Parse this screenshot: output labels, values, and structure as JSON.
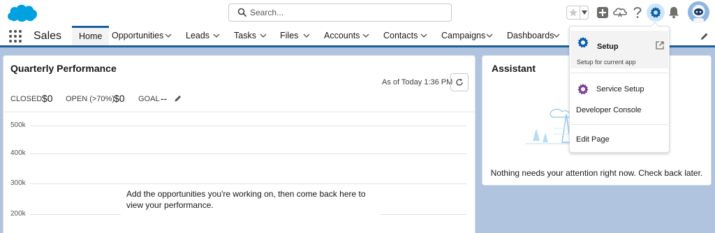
{
  "header": {
    "search_placeholder": "Search..."
  },
  "nav": {
    "app_name": "Sales",
    "tabs": [
      {
        "label": "Home"
      },
      {
        "label": "Opportunities"
      },
      {
        "label": "Leads"
      },
      {
        "label": "Tasks"
      },
      {
        "label": "Files"
      },
      {
        "label": "Accounts"
      },
      {
        "label": "Contacts"
      },
      {
        "label": "Campaigns"
      },
      {
        "label": "Dashboards"
      }
    ]
  },
  "quarterly": {
    "title": "Quarterly Performance",
    "as_of": "As of Today 1:36 PM",
    "closed_label": "CLOSED",
    "closed_value": "$0",
    "open_label": "OPEN (>70%)",
    "open_value": "$0",
    "goal_label": "GOAL",
    "goal_value": "--",
    "y_ticks": [
      "500k",
      "400k",
      "300k",
      "200k"
    ],
    "empty_message": "Add the opportunities you're working on, then come back here to view your performance."
  },
  "assistant": {
    "title": "Assistant",
    "message": "Nothing needs your attention right now. Check back later."
  },
  "setup_menu": {
    "setup_label": "Setup",
    "setup_sub": "Setup for current app",
    "service_setup_label": "Service Setup",
    "developer_console_label": "Developer Console",
    "edit_page_label": "Edit Page"
  },
  "colors": {
    "brand_blue": "#1b5e9e",
    "setup_gear": "#0b5cab",
    "service_gear": "#7f3f98"
  }
}
